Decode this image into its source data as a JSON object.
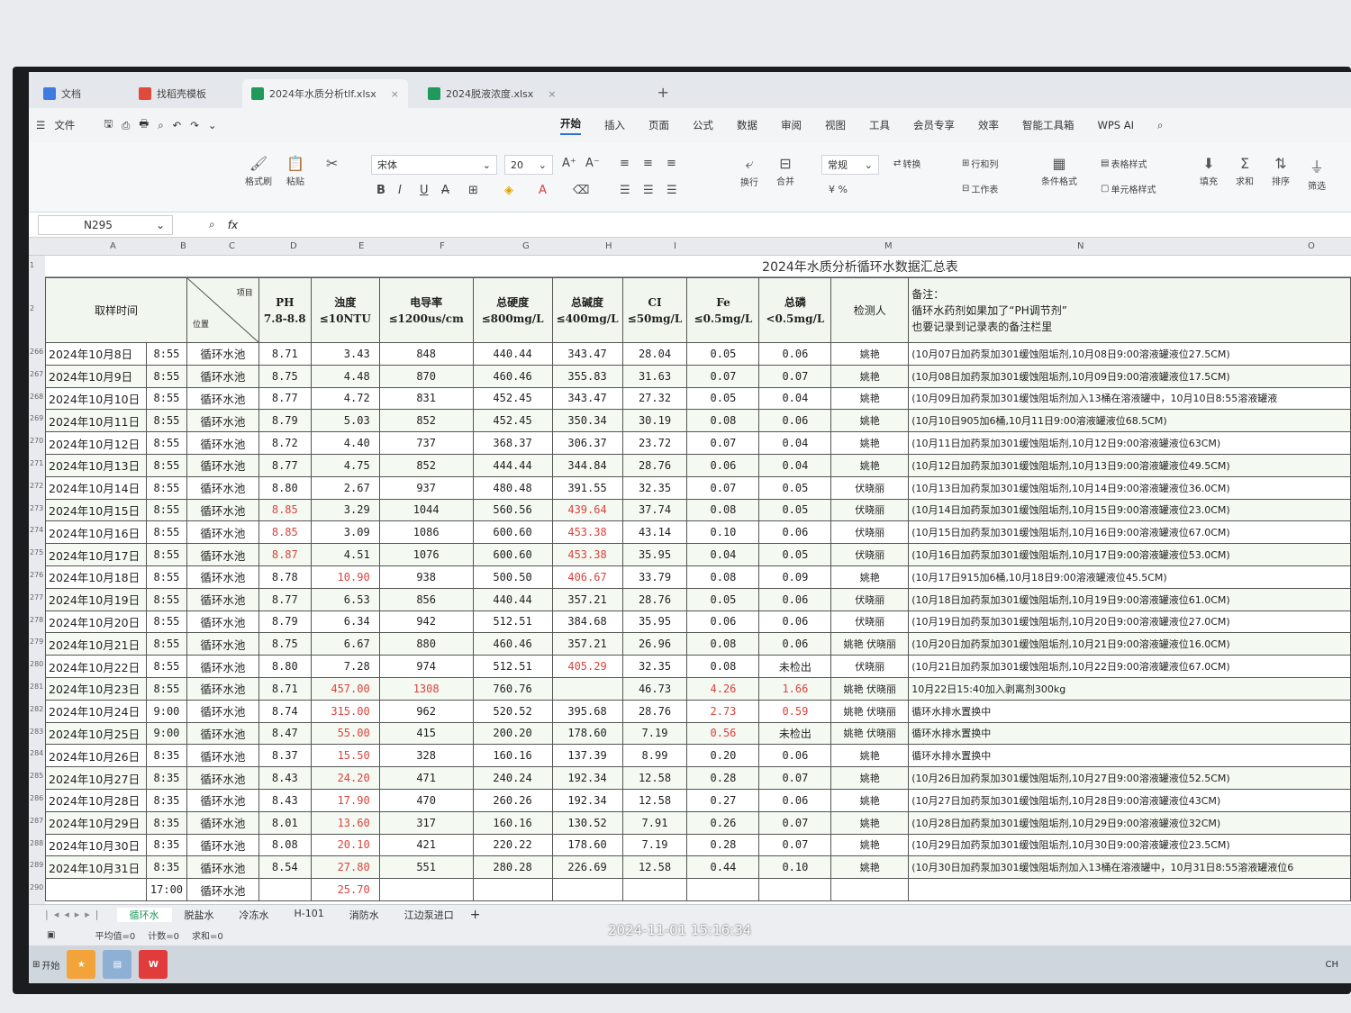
{
  "tabs": [
    {
      "label": "文档",
      "icon": "doc-icon",
      "color": "#3d7be0"
    },
    {
      "label": "找稻壳模板",
      "icon": "docer-icon",
      "color": "#e04a3d"
    },
    {
      "label": "2024年水质分析tlf.xlsx",
      "icon": "sheet-icon",
      "color": "#1f9a5a",
      "active": true
    },
    {
      "label": "2024脱液浓度.xlsx",
      "icon": "sheet-icon",
      "color": "#1f9a5a"
    }
  ],
  "menu": {
    "file": "文件",
    "ribbon_tabs": [
      "开始",
      "插入",
      "页面",
      "公式",
      "数据",
      "审阅",
      "视图",
      "工具",
      "会员专享",
      "效率",
      "智能工具箱",
      "WPS AI"
    ]
  },
  "ribbon": {
    "format_painter": "格式刷",
    "paste": "粘贴",
    "font_name": "宋体",
    "font_size": "20",
    "wrap": "换行",
    "merge": "合并",
    "number_format": "常规",
    "convert": "转换",
    "rows_cols": "行和列",
    "worksheet": "工作表",
    "cond_format": "条件格式",
    "table_style": "表格样式",
    "cell_style": "单元格样式",
    "fill": "填充",
    "sum": "求和",
    "sort": "排序",
    "filter": "筛选"
  },
  "namebox": "N295",
  "fx": "fx",
  "columns": [
    "A",
    "B",
    "C",
    "D",
    "E",
    "F",
    "G",
    "H",
    "I",
    "M",
    "N",
    "O"
  ],
  "sheet": {
    "title": "2024年水质分析循环水数据汇总表",
    "headers": {
      "time": "取样时间",
      "item": "项目",
      "pos": "位置",
      "ph": "PH",
      "ph_limit": "7.8-8.8",
      "turb": "浊度",
      "turb_limit": "≤10NTU",
      "cond": "电导率",
      "cond_limit": "≤1200us/cm",
      "hard": "总硬度",
      "hard_limit": "≤800mg/L",
      "alk": "总碱度",
      "alk_limit": "≤400mg/L",
      "cl": "CI",
      "cl_limit": "≤50mg/L",
      "fe": "Fe",
      "fe_limit": "≤0.5mg/L",
      "p": "总磷",
      "p_limit": "<0.5mg/L",
      "tester": "检测人",
      "note1": "备注：",
      "note2": "循环水药剂如果加了“PH调节剂”",
      "note3": "也要记录到记录表的备注栏里"
    },
    "row_numbers": [
      "266",
      "267",
      "268",
      "269",
      "270",
      "271",
      "272",
      "273",
      "274",
      "275",
      "276",
      "277",
      "278",
      "279",
      "280",
      "281",
      "282",
      "283",
      "284",
      "285",
      "286",
      "287",
      "288",
      "289",
      "290"
    ],
    "rows": [
      {
        "date": "2024年10月8日",
        "time": "8:55",
        "site": "循环水池",
        "ph": "8.71",
        "turb": "3.43",
        "cond": "848",
        "hard": "440.44",
        "alk": "343.47",
        "cl": "28.04",
        "fe": "0.05",
        "p": "0.06",
        "tester": "姚艳",
        "note": "(10月07日加药泵加301缓蚀阻垢剂,10月08日9:00溶液罐液位27.5CM)"
      },
      {
        "date": "2024年10月9日",
        "time": "8:55",
        "site": "循环水池",
        "ph": "8.75",
        "turb": "4.48",
        "cond": "870",
        "hard": "460.46",
        "alk": "355.83",
        "cl": "31.63",
        "fe": "0.07",
        "p": "0.07",
        "tester": "姚艳",
        "note": "(10月08日加药泵加301缓蚀阻垢剂,10月09日9:00溶液罐液位17.5CM)"
      },
      {
        "date": "2024年10月10日",
        "time": "8:55",
        "site": "循环水池",
        "ph": "8.77",
        "turb": "4.72",
        "cond": "831",
        "hard": "452.45",
        "alk": "343.47",
        "cl": "27.32",
        "fe": "0.05",
        "p": "0.04",
        "tester": "姚艳",
        "note": "(10月09日加药泵加301缓蚀阻垢剂加入13桶在溶液罐中，10月10日8:55溶液罐液"
      },
      {
        "date": "2024年10月11日",
        "time": "8:55",
        "site": "循环水池",
        "ph": "8.79",
        "turb": "5.03",
        "cond": "852",
        "hard": "452.45",
        "alk": "350.34",
        "cl": "30.19",
        "fe": "0.08",
        "p": "0.06",
        "tester": "姚艳",
        "note": "(10月10日905加6桶,10月11日9:00溶液罐液位68.5CM)"
      },
      {
        "date": "2024年10月12日",
        "time": "8:55",
        "site": "循环水池",
        "ph": "8.72",
        "turb": "4.40",
        "cond": "737",
        "hard": "368.37",
        "alk": "306.37",
        "cl": "23.72",
        "fe": "0.07",
        "p": "0.04",
        "tester": "姚艳",
        "note": "(10月11日加药泵加301缓蚀阻垢剂,10月12日9:00溶液罐液位63CM)"
      },
      {
        "date": "2024年10月13日",
        "time": "8:55",
        "site": "循环水池",
        "ph": "8.77",
        "turb": "4.75",
        "cond": "852",
        "hard": "444.44",
        "alk": "344.84",
        "cl": "28.76",
        "fe": "0.06",
        "p": "0.04",
        "tester": "姚艳",
        "note": "(10月12日加药泵加301缓蚀阻垢剂,10月13日9:00溶液罐液位49.5CM)"
      },
      {
        "date": "2024年10月14日",
        "time": "8:55",
        "site": "循环水池",
        "ph": "8.80",
        "turb": "2.67",
        "cond": "937",
        "hard": "480.48",
        "alk": "391.55",
        "cl": "32.35",
        "fe": "0.07",
        "p": "0.05",
        "tester": "伏晓丽",
        "note": "(10月13日加药泵加301缓蚀阻垢剂,10月14日9:00溶液罐液位36.0CM)"
      },
      {
        "date": "2024年10月15日",
        "time": "8:55",
        "site": "循环水池",
        "ph": "8.85",
        "turb": "3.29",
        "cond": "1044",
        "hard": "560.56",
        "alk": "439.64",
        "cl": "37.74",
        "fe": "0.08",
        "p": "0.05",
        "tester": "伏晓丽",
        "note": "(10月14日加药泵加301缓蚀阻垢剂,10月15日9:00溶液罐液位23.0CM)",
        "red": [
          "ph",
          "alk"
        ]
      },
      {
        "date": "2024年10月16日",
        "time": "8:55",
        "site": "循环水池",
        "ph": "8.85",
        "turb": "3.09",
        "cond": "1086",
        "hard": "600.60",
        "alk": "453.38",
        "cl": "43.14",
        "fe": "0.10",
        "p": "0.06",
        "tester": "伏晓丽",
        "note": "(10月15日加药泵加301缓蚀阻垢剂,10月16日9:00溶液罐液位67.0CM)",
        "red": [
          "ph",
          "alk"
        ]
      },
      {
        "date": "2024年10月17日",
        "time": "8:55",
        "site": "循环水池",
        "ph": "8.87",
        "turb": "4.51",
        "cond": "1076",
        "hard": "600.60",
        "alk": "453.38",
        "cl": "35.95",
        "fe": "0.04",
        "p": "0.05",
        "tester": "伏晓丽",
        "note": "(10月16日加药泵加301缓蚀阻垢剂,10月17日9:00溶液罐液位53.0CM)",
        "red": [
          "ph",
          "alk"
        ]
      },
      {
        "date": "2024年10月18日",
        "time": "8:55",
        "site": "循环水池",
        "ph": "8.78",
        "turb": "10.90",
        "cond": "938",
        "hard": "500.50",
        "alk": "406.67",
        "cl": "33.79",
        "fe": "0.08",
        "p": "0.09",
        "tester": "姚艳",
        "note": "(10月17日915加6桶,10月18日9:00溶液罐液位45.5CM)",
        "red": [
          "turb",
          "alk"
        ]
      },
      {
        "date": "2024年10月19日",
        "time": "8:55",
        "site": "循环水池",
        "ph": "8.77",
        "turb": "6.53",
        "cond": "856",
        "hard": "440.44",
        "alk": "357.21",
        "cl": "28.76",
        "fe": "0.05",
        "p": "0.06",
        "tester": "伏晓丽",
        "note": "(10月18日加药泵加301缓蚀阻垢剂,10月19日9:00溶液罐液位61.0CM)"
      },
      {
        "date": "2024年10月20日",
        "time": "8:55",
        "site": "循环水池",
        "ph": "8.79",
        "turb": "6.34",
        "cond": "942",
        "hard": "512.51",
        "alk": "384.68",
        "cl": "35.95",
        "fe": "0.06",
        "p": "0.06",
        "tester": "伏晓丽",
        "note": "(10月19日加药泵加301缓蚀阻垢剂,10月20日9:00溶液罐液位27.0CM)"
      },
      {
        "date": "2024年10月21日",
        "time": "8:55",
        "site": "循环水池",
        "ph": "8.75",
        "turb": "6.67",
        "cond": "880",
        "hard": "460.46",
        "alk": "357.21",
        "cl": "26.96",
        "fe": "0.08",
        "p": "0.06",
        "tester": "姚艳 伏晓丽",
        "note": "(10月20日加药泵加301缓蚀阻垢剂,10月21日9:00溶液罐液位16.0CM)"
      },
      {
        "date": "2024年10月22日",
        "time": "8:55",
        "site": "循环水池",
        "ph": "8.80",
        "turb": "7.28",
        "cond": "974",
        "hard": "512.51",
        "alk": "405.29",
        "cl": "32.35",
        "fe": "0.08",
        "p": "未检出",
        "tester": "伏晓丽",
        "note": "(10月21日加药泵加301缓蚀阻垢剂,10月22日9:00溶液罐液位67.0CM)",
        "red": [
          "alk"
        ]
      },
      {
        "date": "2024年10月23日",
        "time": "8:55",
        "site": "循环水池",
        "ph": "8.71",
        "turb": "457.00",
        "cond": "1308",
        "hard": "760.76",
        "alk": "",
        "cl": "46.73",
        "fe": "4.26",
        "p": "1.66",
        "tester": "姚艳 伏晓丽",
        "note": "10月22日15:40加入剥离剂300kg",
        "red": [
          "turb",
          "cond",
          "fe",
          "p"
        ]
      },
      {
        "date": "2024年10月24日",
        "time": "9:00",
        "site": "循环水池",
        "ph": "8.74",
        "turb": "315.00",
        "cond": "962",
        "hard": "520.52",
        "alk": "395.68",
        "cl": "28.76",
        "fe": "2.73",
        "p": "0.59",
        "tester": "姚艳 伏晓丽",
        "note": "循环水排水置换中",
        "red": [
          "turb",
          "fe",
          "p"
        ]
      },
      {
        "date": "2024年10月25日",
        "time": "9:00",
        "site": "循环水池",
        "ph": "8.47",
        "turb": "55.00",
        "cond": "415",
        "hard": "200.20",
        "alk": "178.60",
        "cl": "7.19",
        "fe": "0.56",
        "p": "未检出",
        "tester": "姚艳 伏晓丽",
        "note": "循环水排水置换中",
        "red": [
          "turb",
          "fe"
        ]
      },
      {
        "date": "2024年10月26日",
        "time": "8:35",
        "site": "循环水池",
        "ph": "8.37",
        "turb": "15.50",
        "cond": "328",
        "hard": "160.16",
        "alk": "137.39",
        "cl": "8.99",
        "fe": "0.20",
        "p": "0.06",
        "tester": "姚艳",
        "note": "循环水排水置换中",
        "red": [
          "turb"
        ]
      },
      {
        "date": "2024年10月27日",
        "time": "8:35",
        "site": "循环水池",
        "ph": "8.43",
        "turb": "24.20",
        "cond": "471",
        "hard": "240.24",
        "alk": "192.34",
        "cl": "12.58",
        "fe": "0.28",
        "p": "0.07",
        "tester": "姚艳",
        "note": "(10月26日加药泵加301缓蚀阻垢剂,10月27日9:00溶液罐液位52.5CM)",
        "red": [
          "turb"
        ]
      },
      {
        "date": "2024年10月28日",
        "time": "8:35",
        "site": "循环水池",
        "ph": "8.43",
        "turb": "17.90",
        "cond": "470",
        "hard": "260.26",
        "alk": "192.34",
        "cl": "12.58",
        "fe": "0.27",
        "p": "0.06",
        "tester": "姚艳",
        "note": "(10月27日加药泵加301缓蚀阻垢剂,10月28日9:00溶液罐液位43CM)",
        "red": [
          "turb"
        ]
      },
      {
        "date": "2024年10月29日",
        "time": "8:35",
        "site": "循环水池",
        "ph": "8.01",
        "turb": "13.60",
        "cond": "317",
        "hard": "160.16",
        "alk": "130.52",
        "cl": "7.91",
        "fe": "0.26",
        "p": "0.07",
        "tester": "姚艳",
        "note": "(10月28日加药泵加301缓蚀阻垢剂,10月29日9:00溶液罐液位32CM)",
        "red": [
          "turb"
        ]
      },
      {
        "date": "2024年10月30日",
        "time": "8:35",
        "site": "循环水池",
        "ph": "8.08",
        "turb": "20.10",
        "cond": "421",
        "hard": "220.22",
        "alk": "178.60",
        "cl": "7.19",
        "fe": "0.28",
        "p": "0.07",
        "tester": "姚艳",
        "note": "(10月29日加药泵加301缓蚀阻垢剂,10月30日9:00溶液罐液位23.5CM)",
        "red": [
          "turb"
        ]
      },
      {
        "date": "2024年10月31日",
        "time": "8:35",
        "site": "循环水池",
        "ph": "8.54",
        "turb": "27.80",
        "cond": "551",
        "hard": "280.28",
        "alk": "226.69",
        "cl": "12.58",
        "fe": "0.44",
        "p": "0.10",
        "tester": "姚艳",
        "note": "(10月30日加药泵加301缓蚀阻垢剂加入13桶在溶液罐中，10月31日8:55溶液罐液位6",
        "red": [
          "turb"
        ]
      },
      {
        "date": "",
        "time": "17:00",
        "site": "循环水池",
        "ph": "",
        "turb": "25.70",
        "cond": "",
        "hard": "",
        "alk": "",
        "cl": "",
        "fe": "",
        "p": "",
        "tester": "",
        "note": "",
        "red": [
          "turb"
        ]
      }
    ]
  },
  "sheet_tabs": [
    "循环水",
    "脱盐水",
    "冷冻水",
    "H-101",
    "消防水",
    "江边泵进口"
  ],
  "add_sheet": "+",
  "status": {
    "avg": "平均值=0",
    "count": "计数=0",
    "sum": "求和=0"
  },
  "taskbar": {
    "start": "开始",
    "lang": "CH"
  },
  "timestamp": "2024-11-01 15:16:34"
}
